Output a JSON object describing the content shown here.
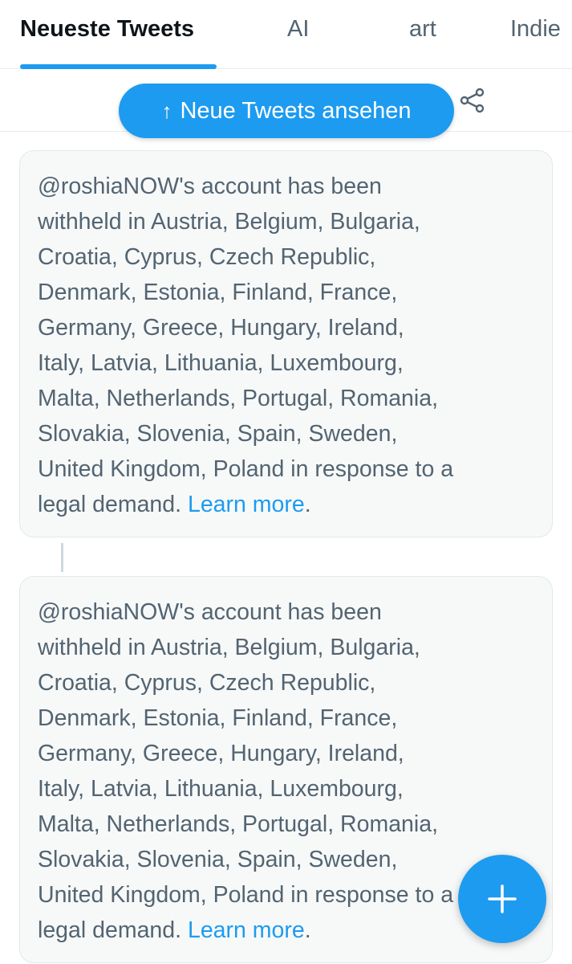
{
  "tabs": [
    {
      "label": "Neueste Tweets",
      "active": true
    },
    {
      "label": "AI",
      "active": false
    },
    {
      "label": "art",
      "active": false
    },
    {
      "label": "Indie",
      "active": false
    }
  ],
  "new_tweets_pill": {
    "arrow": "↑",
    "label": "Neue Tweets ansehen"
  },
  "icons": {
    "share": "share-icon",
    "compose": "plus-icon"
  },
  "colors": {
    "accent": "#1d9bf0",
    "text_muted": "#536471",
    "card_bg": "#f7f9f9"
  },
  "cards": [
    {
      "lines": [
        "@roshiaNOW's account has been",
        "withheld in Austria, Belgium, Bulgaria,",
        "Croatia, Cyprus, Czech Republic,",
        "Denmark, Estonia, Finland, France,",
        "Germany, Greece, Hungary, Ireland,",
        "Italy, Latvia, Lithuania, Luxembourg,",
        "Malta, Netherlands, Portugal, Romania,",
        "Slovakia, Slovenia, Spain, Sweden,",
        "United Kingdom, Poland in response to a",
        "legal demand."
      ],
      "link": "Learn more",
      "suffix": "."
    },
    {
      "lines": [
        "@roshiaNOW's account has been",
        "withheld in Austria, Belgium, Bulgaria,",
        "Croatia, Cyprus, Czech Republic,",
        "Denmark, Estonia, Finland, France,",
        "Germany, Greece, Hungary, Ireland,",
        "Italy, Latvia, Lithuania, Luxembourg,",
        "Malta, Netherlands, Portugal, Romania,",
        "Slovakia, Slovenia, Spain, Sweden,",
        "United Kingdom, Poland in response to a",
        "legal demand."
      ],
      "link": "Learn more",
      "suffix": "."
    }
  ]
}
